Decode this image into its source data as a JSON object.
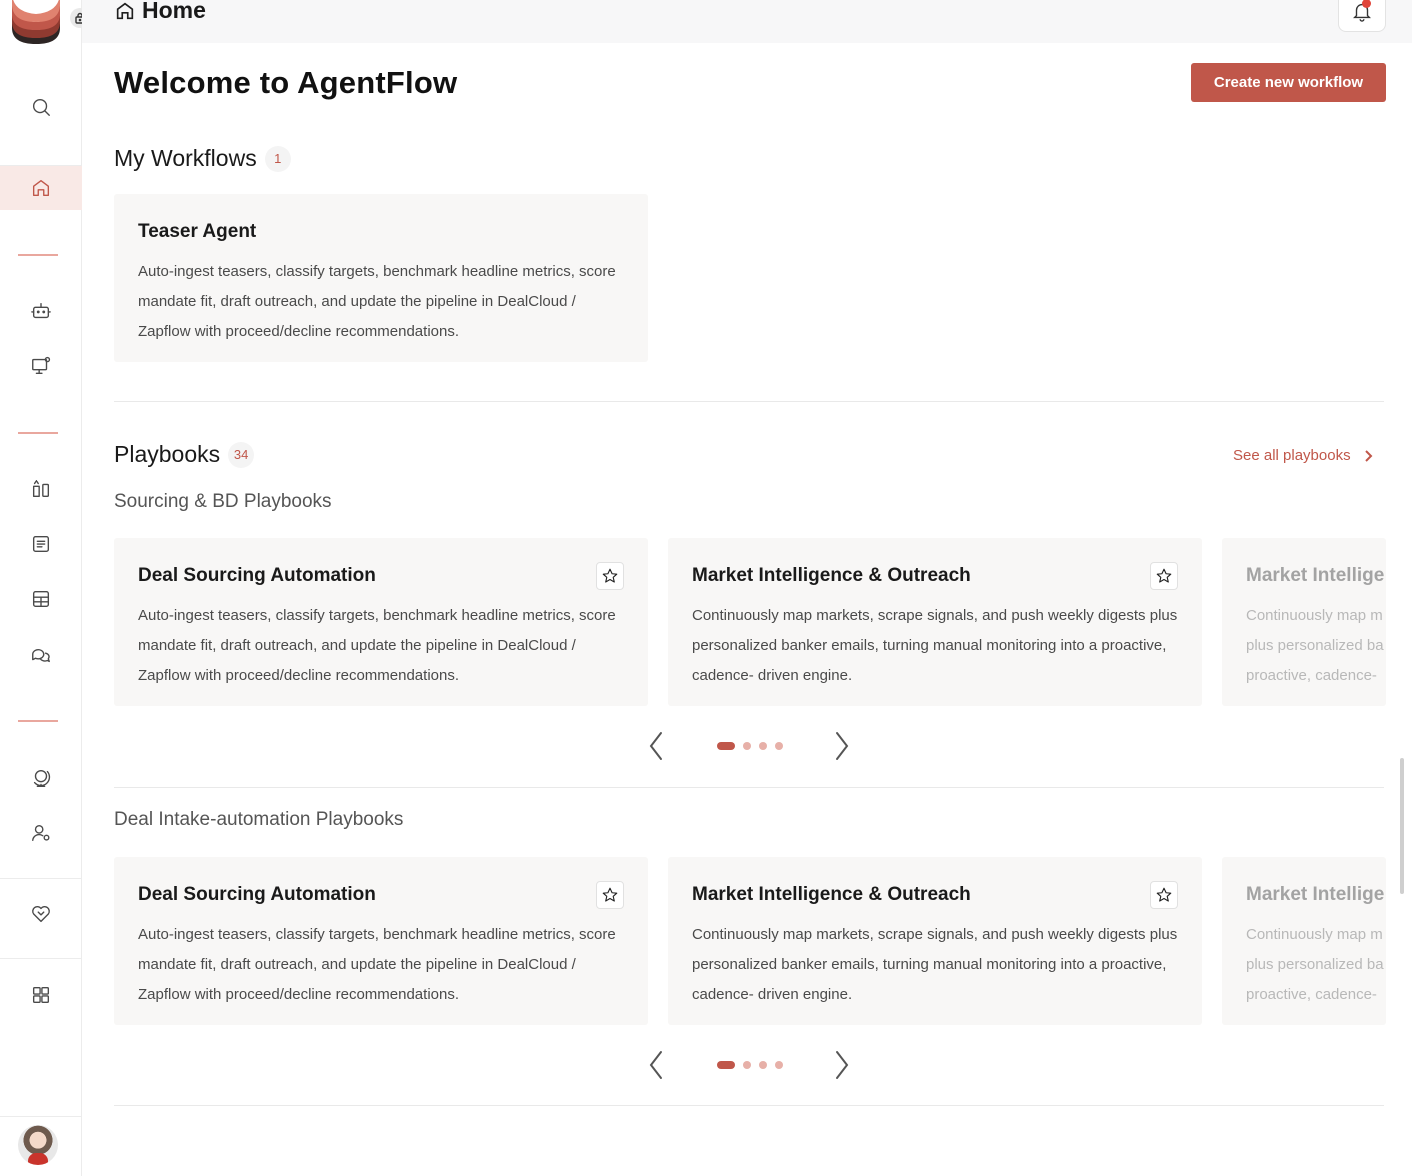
{
  "topbar": {
    "breadcrumb": "Home"
  },
  "main": {
    "welcome": "Welcome to AgentFlow",
    "create_label": "Create new workflow"
  },
  "workflows": {
    "title": "My Workflows",
    "count": "1",
    "items": [
      {
        "title": "Teaser Agent",
        "desc": "Auto-ingest teasers, classify targets, benchmark headline metrics, score mandate fit, draft outreach, and update the pipeline in DealCloud / Zapflow with proceed/decline recommendations."
      }
    ]
  },
  "playbooks": {
    "title": "Playbooks",
    "count": "34",
    "see_all": "See all playbooks",
    "groups": [
      {
        "title": "Sourcing & BD Playbooks",
        "cards": [
          {
            "title": "Deal Sourcing Automation",
            "desc": "Auto-ingest teasers, classify targets, benchmark headline metrics, score mandate fit, draft outreach, and update the pipeline in DealCloud / Zapflow with proceed/decline recommendations."
          },
          {
            "title": "Market Intelligence & Outreach",
            "desc": "Continuously map markets, scrape signals, and push weekly digests plus personalized banker emails, turning manual monitoring into a proactive, cadence- driven engine."
          },
          {
            "title": "Market Intellige",
            "desc_lines": [
              "Continuously map m",
              "plus personalized ba",
              "proactive, cadence-"
            ]
          }
        ]
      },
      {
        "title": "Deal Intake-automation Playbooks",
        "cards": [
          {
            "title": "Deal Sourcing Automation",
            "desc": "Auto-ingest teasers, classify targets, benchmark headline metrics, score mandate fit, draft outreach, and update the pipeline in DealCloud / Zapflow with proceed/decline recommendations."
          },
          {
            "title": "Market Intelligence & Outreach",
            "desc": "Continuously map markets, scrape signals, and push weekly digests plus personalized banker emails, turning manual monitoring into a proactive, cadence- driven engine."
          },
          {
            "title": "Market Intellige",
            "desc_lines": [
              "Continuously map m",
              "plus personalized ba",
              "proactive, cadence-"
            ]
          }
        ]
      }
    ]
  },
  "colors": {
    "accent": "#c0574a",
    "accent_light": "#f9e9e6"
  },
  "sidebar": {
    "icons": [
      "search-icon",
      "home-icon",
      "robot-icon",
      "monitor-settings-icon",
      "compare-icon",
      "document-icon",
      "table-icon",
      "chat-icon",
      "globe-icon",
      "user-settings-icon",
      "handshake-icon",
      "apps-grid-icon"
    ],
    "active": "home-icon"
  }
}
